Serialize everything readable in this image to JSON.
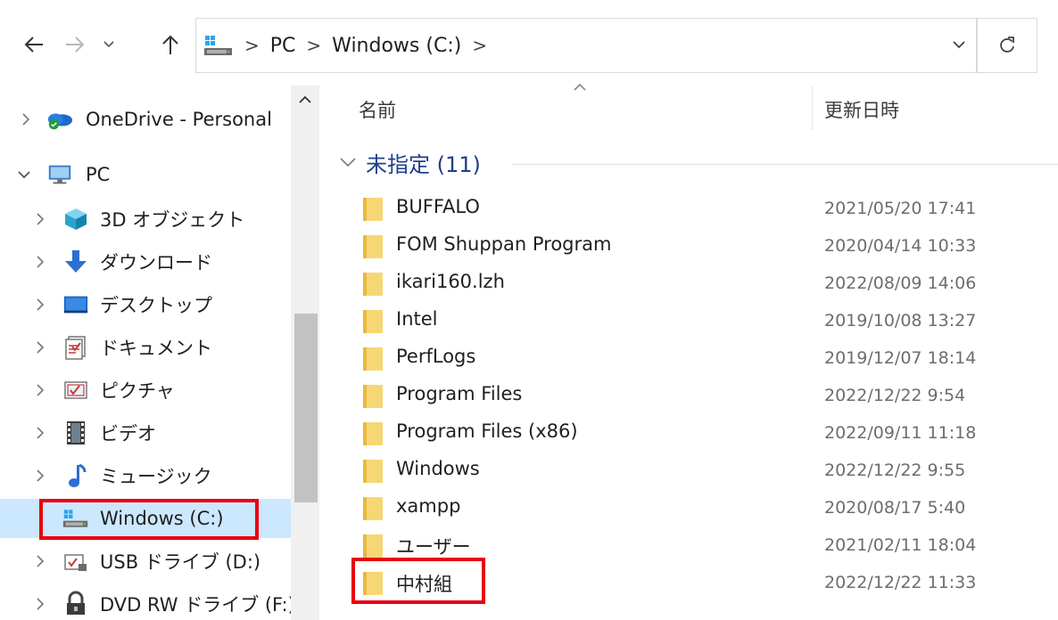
{
  "address_bar": {
    "crumbs": [
      "PC",
      "Windows (C:)"
    ],
    "separator": ">"
  },
  "nav_pane": {
    "items": [
      {
        "label": "OneDrive - Personal",
        "icon": "onedrive-cloud-icon"
      },
      {
        "label": "PC",
        "icon": "pc-monitor-icon"
      },
      {
        "label": "3D オブジェクト",
        "icon": "3d-objects-icon"
      },
      {
        "label": "ダウンロード",
        "icon": "download-arrow-icon"
      },
      {
        "label": "デスクトップ",
        "icon": "desktop-icon"
      },
      {
        "label": "ドキュメント",
        "icon": "documents-icon"
      },
      {
        "label": "ピクチャ",
        "icon": "pictures-icon"
      },
      {
        "label": "ビデオ",
        "icon": "videos-icon"
      },
      {
        "label": "ミュージック",
        "icon": "music-note-icon"
      },
      {
        "label": "Windows (C:)",
        "icon": "drive-c-icon"
      },
      {
        "label": "USB ドライブ (D:)",
        "icon": "usb-drive-icon"
      },
      {
        "label": "DVD RW ドライブ (F:) S",
        "icon": "dvd-drive-icon"
      }
    ]
  },
  "columns": {
    "name": "名前",
    "modified": "更新日時"
  },
  "group": {
    "label": "未指定 (11)"
  },
  "files": [
    {
      "name": "BUFFALO",
      "modified": "2021/05/20 17:41"
    },
    {
      "name": "FOM Shuppan Program",
      "modified": "2020/04/14 10:33"
    },
    {
      "name": "ikari160.lzh",
      "modified": "2022/08/09 14:06"
    },
    {
      "name": "Intel",
      "modified": "2019/10/08 13:27"
    },
    {
      "name": "PerfLogs",
      "modified": "2019/12/07 18:14"
    },
    {
      "name": "Program Files",
      "modified": "2022/12/22 9:54"
    },
    {
      "name": "Program Files (x86)",
      "modified": "2022/09/11 11:18"
    },
    {
      "name": "Windows",
      "modified": "2022/12/22 9:55"
    },
    {
      "name": "xampp",
      "modified": "2020/08/17 5:40"
    },
    {
      "name": "ユーザー",
      "modified": "2021/02/11 18:04"
    },
    {
      "name": "中村組",
      "modified": "2022/12/22 11:33"
    }
  ],
  "colors": {
    "selection": "#cce8ff",
    "highlight_box": "#e8000f",
    "group_text": "#1e3f8a",
    "folder": "#f7d774"
  }
}
